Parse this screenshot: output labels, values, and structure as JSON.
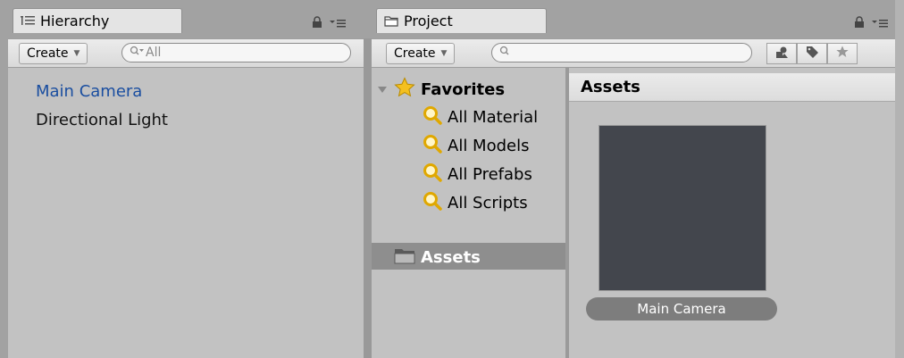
{
  "hierarchy": {
    "tab_label": "Hierarchy",
    "create_label": "Create",
    "search_placeholder": "All",
    "items": [
      {
        "label": "Main Camera",
        "color": "#1a4ea0"
      },
      {
        "label": "Directional Light",
        "color": "#111111"
      }
    ]
  },
  "project": {
    "tab_label": "Project",
    "create_label": "Create",
    "favorites": {
      "label": "Favorites",
      "items": [
        "All Material",
        "All Models",
        "All Prefabs",
        "All Scripts"
      ]
    },
    "assets_folder": "Assets",
    "assets_panel": {
      "header": "Assets",
      "items": [
        {
          "label": "Main Camera",
          "thumb_color": "#43464d"
        }
      ]
    }
  },
  "icons": {
    "lock": "lock-icon",
    "menu": "menu-icon",
    "search": "search-icon",
    "filter_type": "filter-type-icon",
    "filter_label": "label-icon",
    "favorite": "star-icon",
    "folder": "folder-icon"
  }
}
